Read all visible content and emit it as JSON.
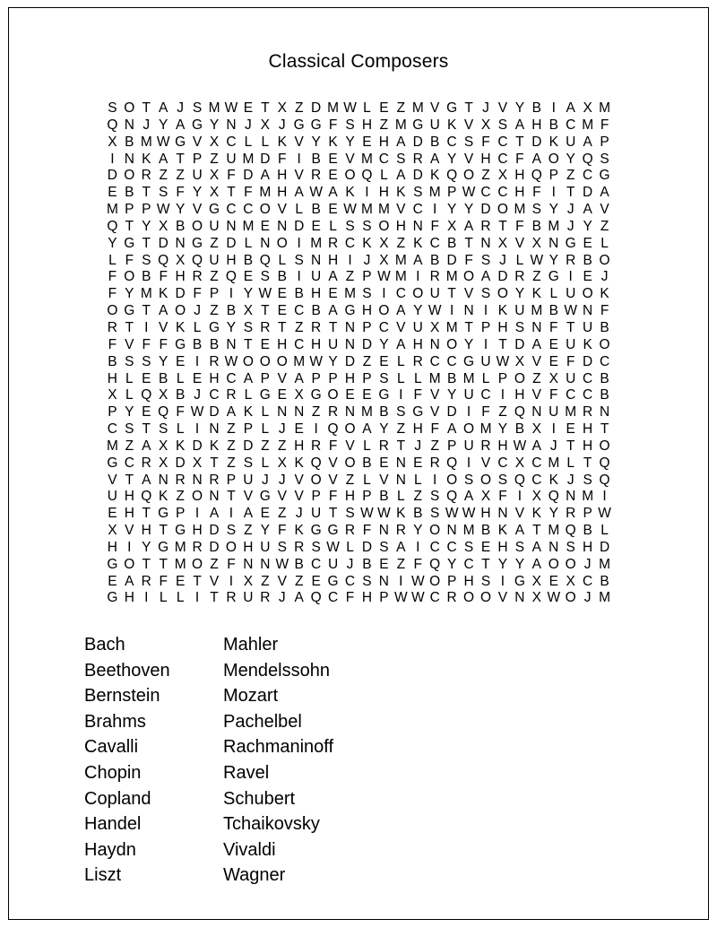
{
  "puzzle": {
    "title": "Classical Composers",
    "grid_rows": [
      "SOTAJSMWETXZDMWLEZMVGTJVYBIAXM",
      "QNJYAGYNJXJGGFSHZMGUKVXSAHBCMF",
      "XBMWGVXCLLKVYKYEHADBCSFCTDKUAP",
      "INKATPZUMDFIBEVMCSRAYVHCFAOYQS",
      "DORZZUXFDAHVREOQLADKQOZXHQPZCG",
      "EBTSFYXTFMHAWAKIHKSMPWCCHFITDA",
      "MPPWYVGCCOVLBEWMMVCIYYDOMSYJAV",
      "QTYXBOUNMENDELSSOHNFXARTFBMJYZ",
      "YGTDNGZDLNOIMRCKXZKCBTNXVXNGEL",
      "LFSQXQUHBQLSNHIJXMABDFSJLWYRBO",
      "FOBFHRZQESBIUAZPWMIRMOADRZGIEJ",
      "FYMKDFPIYWEBHEMSICOUTVSOYKLUOK",
      "OGTAOJZBXTECBAGHOAYWINIKUMBWNF",
      "RTIVKLGYSRTZRTNPCVUXMTPHSNFTUB",
      "FVFFGBBNTEHCHUNDYAHNOYITDAEUKO",
      "BSSYEIRWOOOMWYDZELRCCGUWXVEFDC",
      "HLEBLEHCAPVAPPHPSLLMBMLPOZXUCB",
      "XLQXBJCRLGEXGOEEGIFVYUCIHVFCCB",
      "PYEQFWDAKLNNZRNMBSGVDIFZQNUMRN",
      "CSTSLINZPLJEIQOAYZHFAOMYBXIEHT",
      "MZAXKDKZDZZHRFVLRTJZPURHWAJTHO",
      "GCRXDXTZSLXKQVOBENERQIVCXCMLTQ",
      "VTANRNRPUJJVOVZLVNLIOSOSQCKJSQ",
      "UHQKZONTVGVVPFHPBLZSQAXFIXQNMI",
      "EHTGPIAIAEZJUTSWWKBSWWHNVKYRPW",
      "XVHTGHDSZYFKGGRFNRYONMBKATMQBL",
      "HIYGMRDOHUSRSWLDSAICCSEHSANSHD",
      "GOTTMOZFNNWBCUJBEZFQYCTYYAOOJM",
      "EARFETVIXZVZEGCSNIWOPHSIGXEXCB",
      "GHILLITRURJAQCFHPWWCROOVNXWOJM"
    ],
    "word_list_rows": [
      {
        "left": "Bach",
        "right": "Mahler"
      },
      {
        "left": "Beethoven",
        "right": "Mendelssohn"
      },
      {
        "left": "Bernstein",
        "right": "Mozart"
      },
      {
        "left": "Brahms",
        "right": "Pachelbel"
      },
      {
        "left": "Cavalli",
        "right": "Rachmaninoff"
      },
      {
        "left": "Chopin",
        "right": "Ravel"
      },
      {
        "left": "Copland",
        "right": "Schubert"
      },
      {
        "left": "Handel",
        "right": "Tchaikovsky"
      },
      {
        "left": "Haydn",
        "right": "Vivaldi"
      },
      {
        "left": "Liszt",
        "right": "Wagner"
      }
    ]
  }
}
